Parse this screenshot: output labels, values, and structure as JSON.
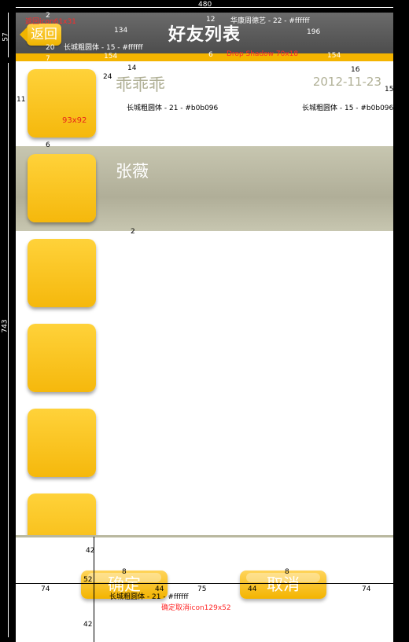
{
  "header": {
    "title": "好友列表",
    "back_label": "返回"
  },
  "rows": [
    {
      "name": "乖乖乖",
      "date": "2012-11-23",
      "avatar_label": "93x92"
    },
    {
      "name": "张薇",
      "date": "",
      "avatar_label": ""
    },
    {
      "name": "",
      "date": "",
      "avatar_label": ""
    },
    {
      "name": "",
      "date": "",
      "avatar_label": ""
    },
    {
      "name": "",
      "date": "",
      "avatar_label": ""
    },
    {
      "name": "",
      "date": "",
      "avatar_label": ""
    }
  ],
  "buttons": {
    "confirm_label": "确定",
    "cancel_label": "取消"
  },
  "annotations": {
    "width_total": "480",
    "height_total": "743",
    "header_height": "57",
    "back_icon_note": "返回icon61x31",
    "title_font_note": "华康周德艺 - 22 - #ffffff",
    "back_font_note": "长城粗圆体 - 15 - #ffffff",
    "name_font_note": "长城粗圆体 - 21 - #b0b096",
    "date_font_note": "长城粗圆体 - 15 - #b0b096",
    "button_font_note": "长城粗圆体 - 21 - #ffffff",
    "button_icon_note": "确定取消icon129x52",
    "dim_134": "134",
    "dim_196": "196",
    "dim_154a": "154",
    "dim_154b": "154",
    "dim_12": "12",
    "dim_20": "20",
    "dim_7": "7",
    "dim_8": "8",
    "dim_2": "2",
    "dim_6a": "6",
    "dim_14": "14",
    "dim_24": "24",
    "dim_11": "11",
    "dim_16": "16",
    "dim_15": "15",
    "dim_6b": "6",
    "dim_2b": "2",
    "dim_42a": "42",
    "dim_52": "52",
    "dim_42b": "42",
    "dim_74a": "74",
    "dim_75": "75",
    "dim_74b": "74",
    "dim_44a": "44",
    "dim_44b": "44",
    "dim_8a": "8",
    "dim_8b": "8",
    "header_gap_note": "Drop Shadow 70x18"
  },
  "colors": {
    "accent": "#f4b400",
    "header": "#5a5a5a",
    "selected_row": "#b8b7a0",
    "text_muted": "#b0b096"
  }
}
